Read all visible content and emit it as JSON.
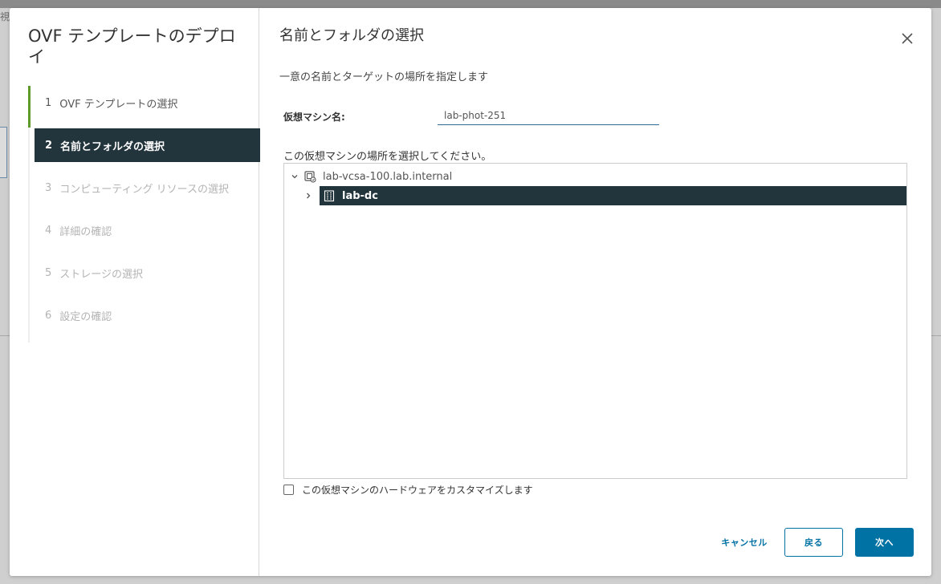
{
  "background": {
    "left_fragment": "視"
  },
  "wizard": {
    "title": "OVF テンプレートのデプロイ",
    "steps": [
      {
        "num": "1",
        "label": "OVF テンプレートの選択",
        "state": "done"
      },
      {
        "num": "2",
        "label": "名前とフォルダの選択",
        "state": "active"
      },
      {
        "num": "3",
        "label": "コンピューティング リソースの選択",
        "state": "pending"
      },
      {
        "num": "4",
        "label": "詳細の確認",
        "state": "pending"
      },
      {
        "num": "5",
        "label": "ストレージの選択",
        "state": "pending"
      },
      {
        "num": "6",
        "label": "設定の確認",
        "state": "pending"
      }
    ]
  },
  "page": {
    "title": "名前とフォルダの選択",
    "description": "一意の名前とターゲットの場所を指定します",
    "vm_name_label": "仮想マシン名:",
    "vm_name_value": "lab-phot-251",
    "location_label": "この仮想マシンの場所を選択してください。",
    "tree": {
      "root": {
        "label": "lab-vcsa-100.lab.internal",
        "icon": "vcenter-icon",
        "expanded": true
      },
      "children": [
        {
          "label": "lab-dc",
          "icon": "datacenter-icon",
          "expanded": false,
          "selected": true
        }
      ]
    },
    "customize_hw_label": "この仮想マシンのハードウェアをカスタマイズします",
    "customize_hw_checked": false
  },
  "footer": {
    "cancel_label": "キャンセル",
    "back_label": "戻る",
    "next_label": "次へ"
  },
  "colors": {
    "accent": "#0072a3",
    "selected_bg": "#22343c",
    "done_step": "#5d9a2a"
  }
}
